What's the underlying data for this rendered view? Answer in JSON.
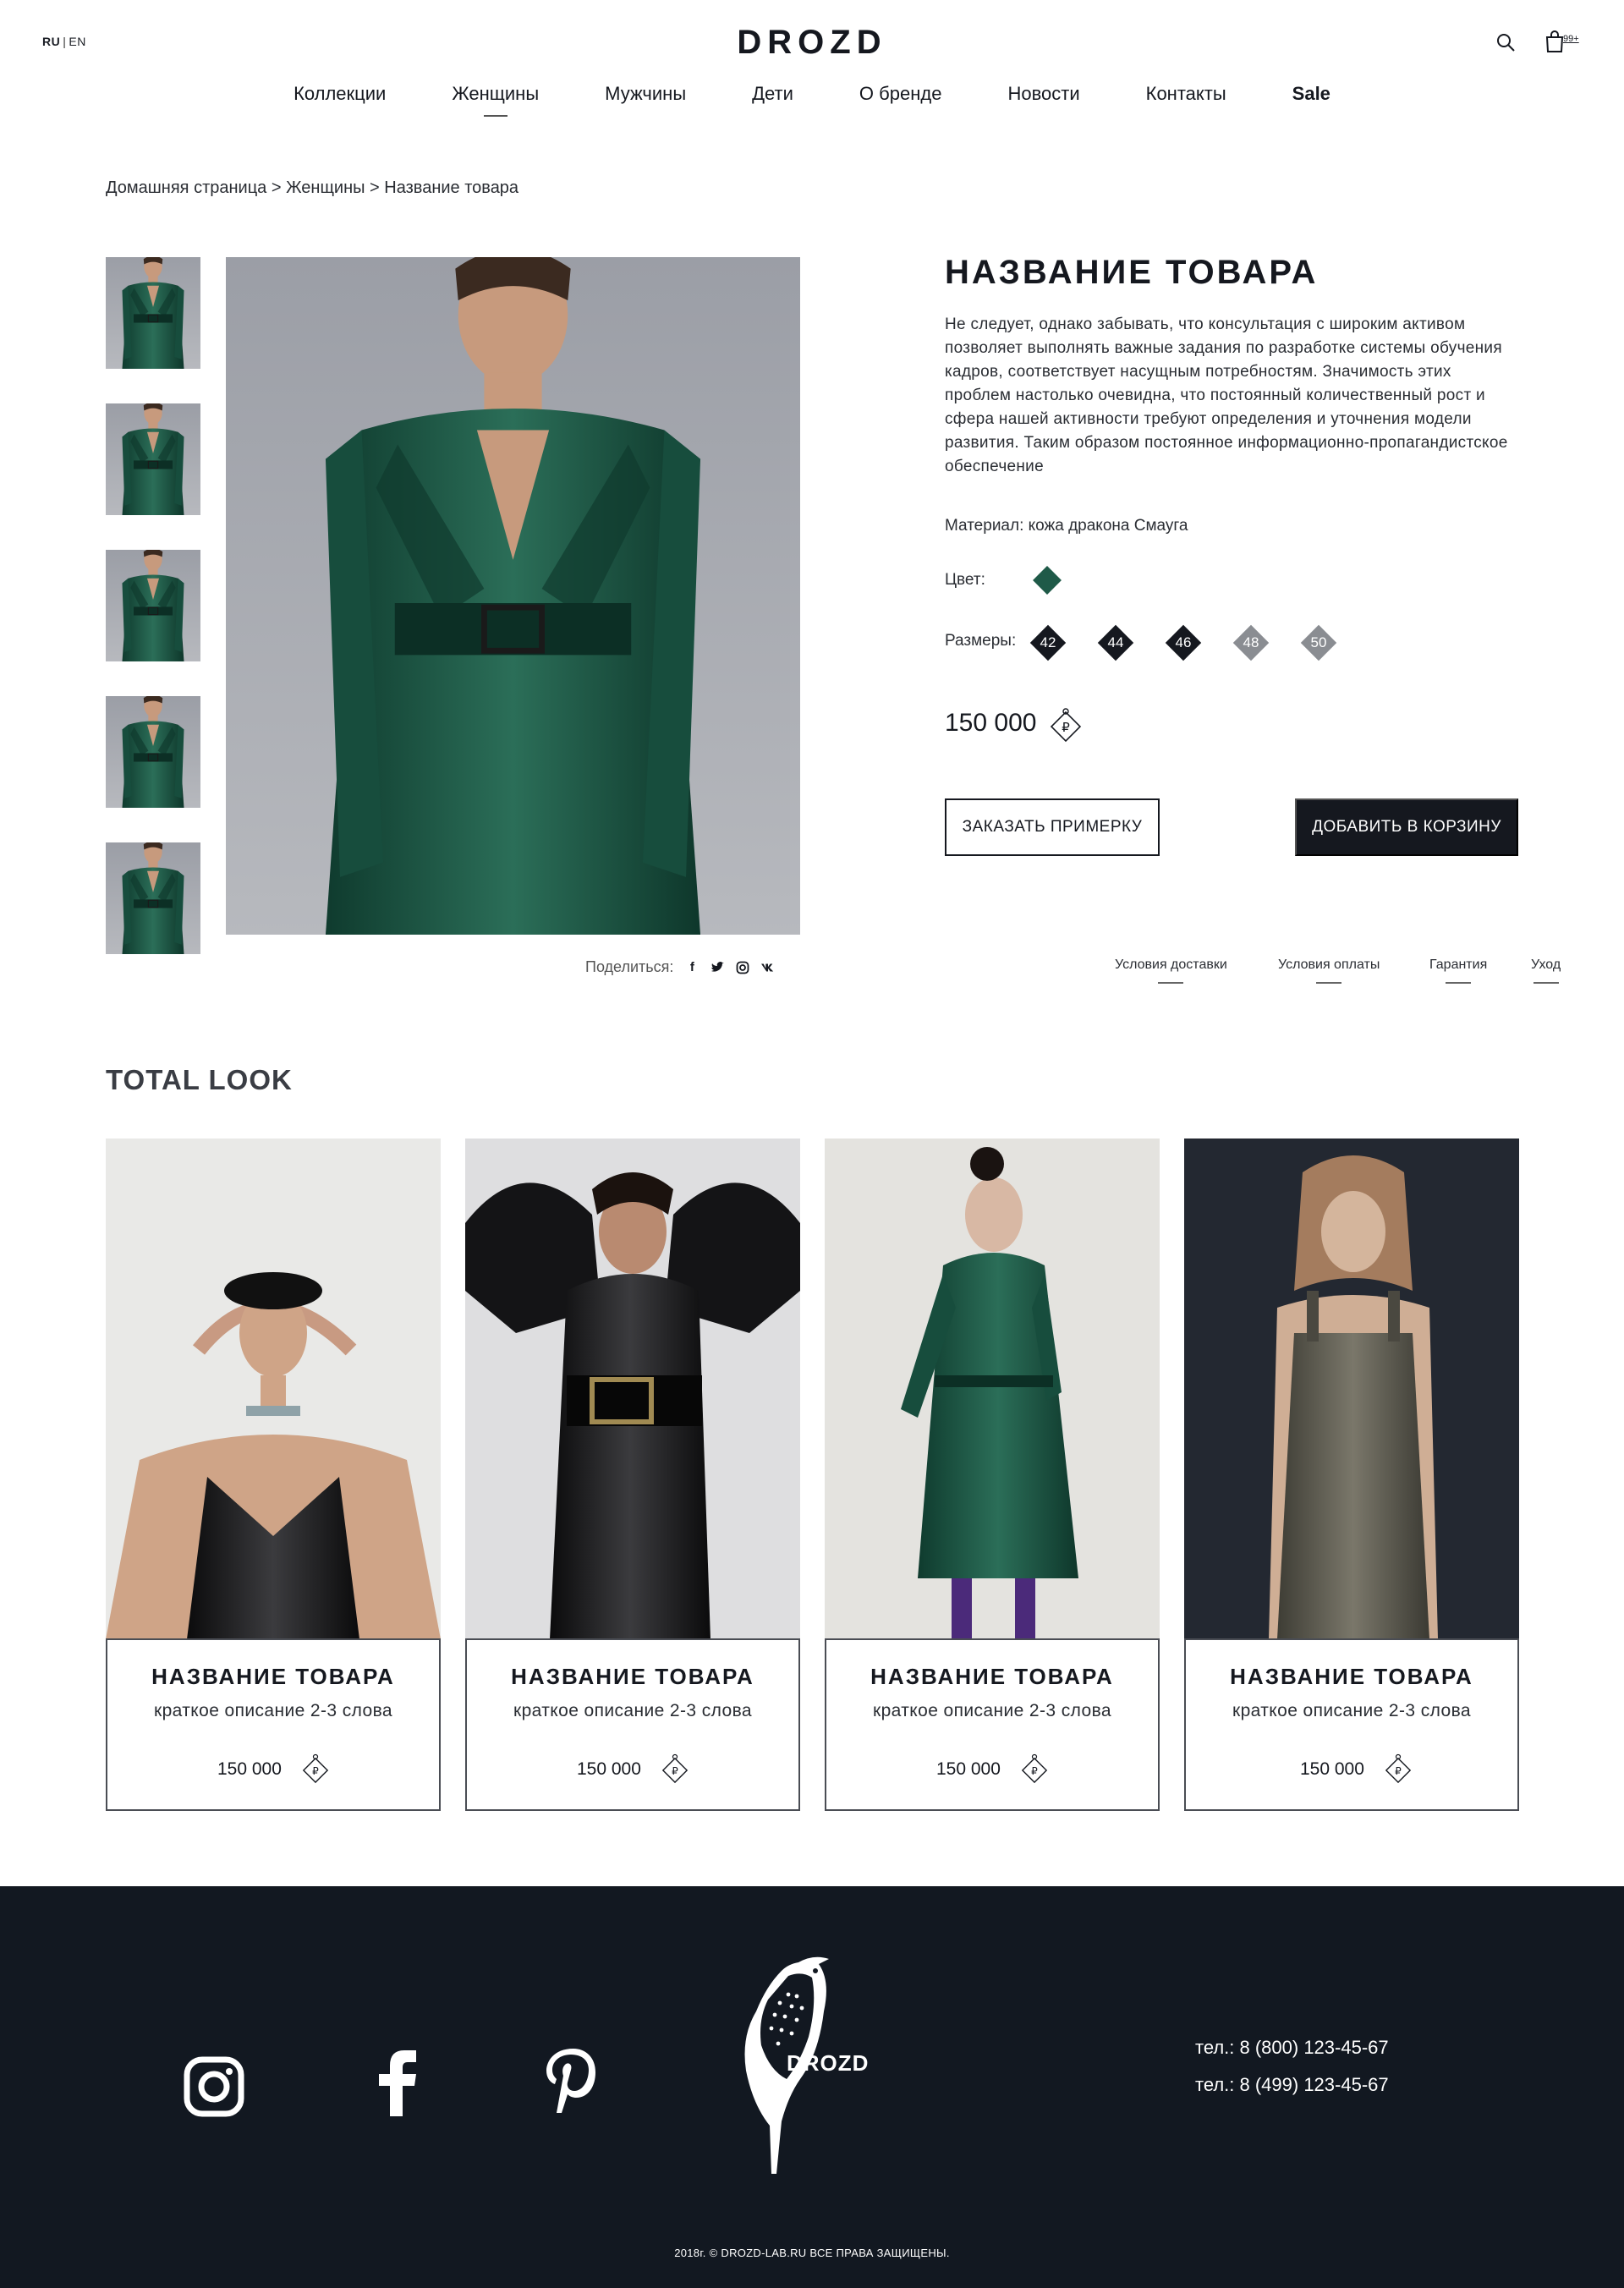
{
  "header": {
    "lang_ru": "RU",
    "lang_sep": "|",
    "lang_en": "EN",
    "logo": "DROZD",
    "cart_count": "99+",
    "icons": [
      "search-icon",
      "cart-icon"
    ]
  },
  "nav": [
    "Коллекции",
    "Женщины",
    "Мужчины",
    "Дети",
    "О бренде",
    "Новости",
    "Контакты",
    "Sale"
  ],
  "nav_active": "Женщины",
  "breadcrumb": "Домашняя страница > Женщины > Название товара",
  "share": {
    "label": "Поделиться:",
    "icons": [
      "facebook-icon",
      "twitter-icon",
      "instagram-icon",
      "vk-icon"
    ]
  },
  "product": {
    "title": "НАЗВАНИЕ ТОВАРА",
    "description": "Не следует, однако забывать, что консультация с широким активом позволяет выполнять важные задания по разработке системы обучения кадров, соответствует насущным потребностям. Значимость этих проблем настолько очевидна, что постоянный количественный рост и сфера нашей активности требуют определения и уточнения модели развития. Таким образом постоянное информационно-пропагандистское обеспечение",
    "material": "Материал: кожа дракона Смауга",
    "color_label": "Цвет:",
    "color_hex": "#1f5a48",
    "sizes_label": "Размеры:",
    "sizes": [
      {
        "label": "42",
        "available": true
      },
      {
        "label": "44",
        "available": true
      },
      {
        "label": "46",
        "available": true
      },
      {
        "label": "48",
        "available": false
      },
      {
        "label": "50",
        "available": false
      }
    ],
    "price": "150 000",
    "currency_symbol": "₽",
    "btn_try": "ЗАКАЗАТЬ ПРИМЕРКУ",
    "btn_cart": "ДОБАВИТЬ В КОРЗИНУ"
  },
  "info_links": [
    "Условия доставки",
    "Условия оплаты",
    "Гарантия",
    "Уход"
  ],
  "total_look": {
    "title": "TOTAL LOOK",
    "items": [
      {
        "title": "НАЗВАНИЕ ТОВАРА",
        "subtitle": "краткое описание 2-3 слова",
        "price": "150 000"
      },
      {
        "title": "НАЗВАНИЕ ТОВАРА",
        "subtitle": "краткое описание 2-3 слова",
        "price": "150 000"
      },
      {
        "title": "НАЗВАНИЕ ТОВАРА",
        "subtitle": "краткое описание 2-3 слова",
        "price": "150 000"
      },
      {
        "title": "НАЗВАНИЕ ТОВАРА",
        "subtitle": "краткое описание 2-3 слова",
        "price": "150 000"
      }
    ]
  },
  "footer": {
    "social_icons": [
      "instagram-icon",
      "facebook-icon",
      "pinterest-icon"
    ],
    "brand": "DROZD",
    "phone1": "тел.: 8 (800) 123-45-67",
    "phone2": "тел.: 8 (499) 123-45-67",
    "copyright": "2018г. © DROZD-LAB.RU ВСЕ ПРАВА ЗАЩИЩЕНЫ."
  },
  "colors": {
    "dark": "#15181f",
    "footer_bg": "#121821",
    "green": "#1f5a48",
    "size_unavailable": "#8a8d92"
  }
}
